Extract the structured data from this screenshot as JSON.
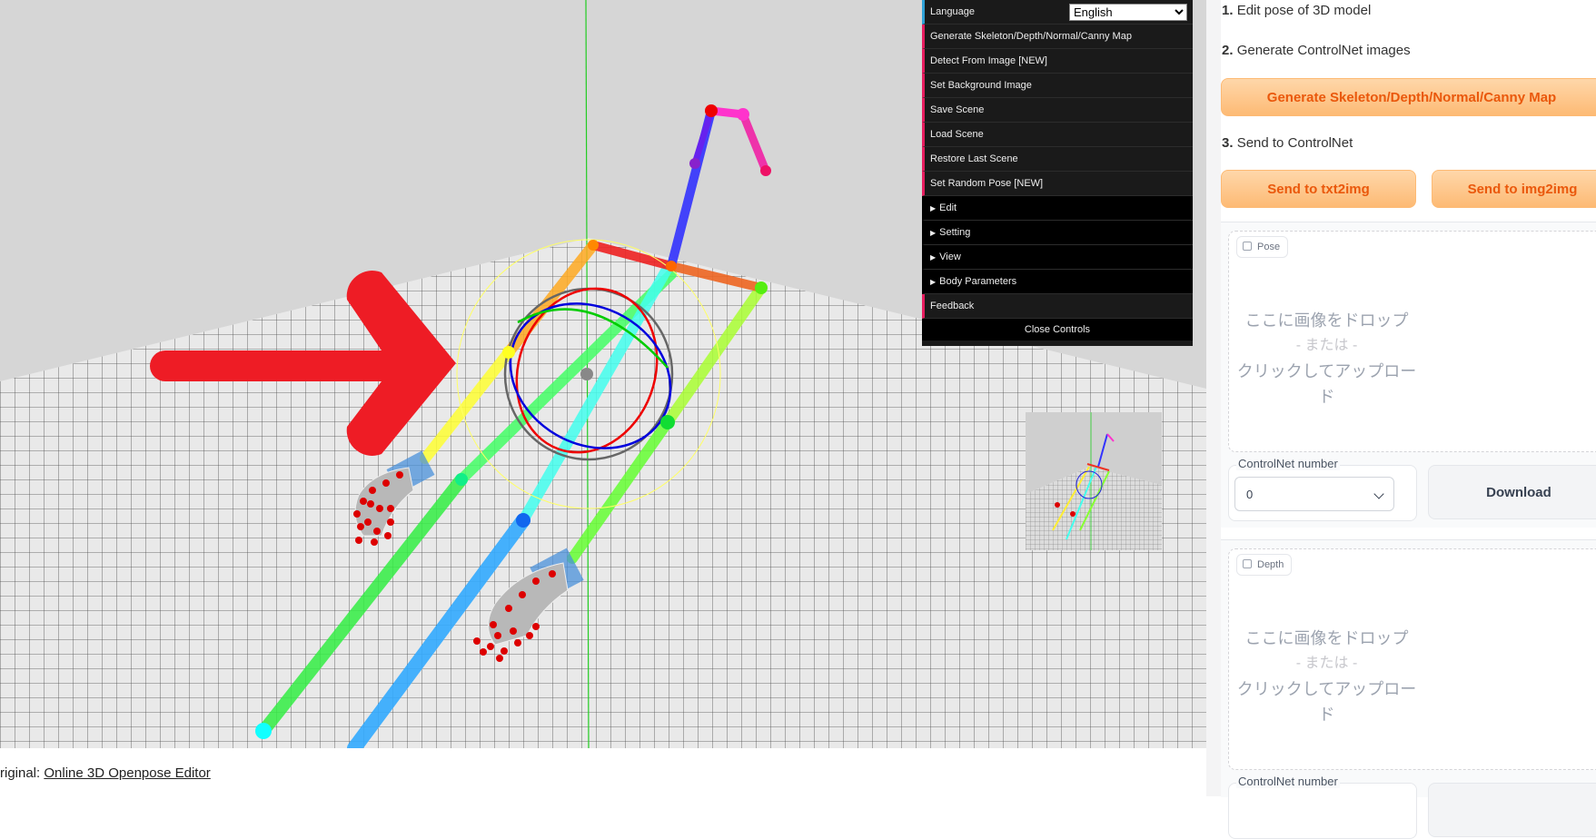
{
  "gui": {
    "language_label": "Language",
    "language_value": "English",
    "items": [
      "Generate Skeleton/Depth/Normal/Canny Map",
      "Detect From Image [NEW]",
      "Set Background Image",
      "Save Scene",
      "Load Scene",
      "Restore Last Scene",
      "Set Random Pose [NEW]"
    ],
    "folders": [
      "Edit",
      "Setting",
      "View",
      "Body Parameters"
    ],
    "feedback": "Feedback",
    "close": "Close Controls"
  },
  "footer": {
    "prefix": "riginal: ",
    "link": "Online 3D Openpose Editor"
  },
  "panel": {
    "step1": {
      "num": "1.",
      "text": "Edit pose of 3D model"
    },
    "step2": {
      "num": "2.",
      "text": "Generate ControlNet images"
    },
    "generate_button": "Generate Skeleton/Depth/Normal/Canny Map",
    "step3": {
      "num": "3.",
      "text": "Send to ControlNet"
    },
    "send_txt2img": "Send to txt2img",
    "send_img2img": "Send to img2img",
    "pose": {
      "label": "Pose",
      "drop_line1": "ここに画像をドロップ",
      "drop_or": "- または -",
      "drop_line2": "クリックしてアップロード",
      "controlnet_label": "ControlNet number",
      "controlnet_value": "0",
      "download": "Download"
    },
    "depth": {
      "label": "Depth",
      "drop_line1": "ここに画像をドロップ",
      "drop_or": "- または -",
      "drop_line2": "クリックしてアップロード",
      "controlnet_label": "ControlNet number"
    }
  },
  "colors": {
    "accent_orange": "#ea580c",
    "gui_bg": "#1a1a1a",
    "gui_button_marker": "#e61d5f",
    "gui_language_marker": "#2fa1d6",
    "arrow_red": "#ee1c25"
  }
}
